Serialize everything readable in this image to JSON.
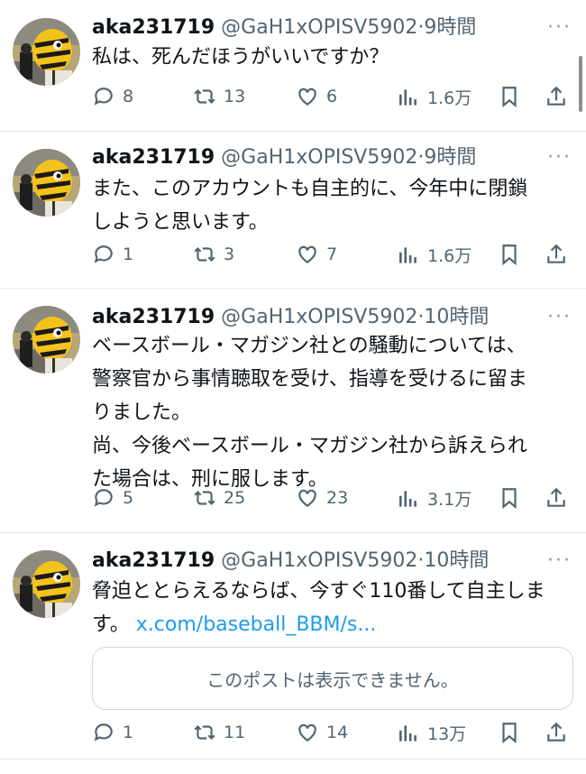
{
  "colors": {
    "link": "#1d9bf0",
    "muted": "#536471",
    "text": "#0f1419"
  },
  "tweets": [
    {
      "name": "aka231719",
      "handle": "@GaH1xOPISV5902",
      "dot": "·",
      "time": "9時間",
      "text": "私は、死んだほうがいいですか？",
      "replies": "8",
      "retweets": "13",
      "likes": "6",
      "views": "1.6万"
    },
    {
      "name": "aka231719",
      "handle": "@GaH1xOPISV5902",
      "dot": "·",
      "time": "9時間",
      "text": "また、このアカウントも自主的に、今年中に閉鎖\nしようと思います。",
      "replies": "1",
      "retweets": "3",
      "likes": "7",
      "views": "1.6万"
    },
    {
      "name": "aka231719",
      "handle": "@GaH1xOPISV5902",
      "dot": "·",
      "time": "10時間",
      "text": "ベースボール・マガジン社との騒動については、\n警察官から事情聴取を受け、指導を受けるに留ま\nりました。\n尚、今後ベースボール・マガジン社から訴えられ\nた場合は、刑に服します。",
      "replies": "5",
      "retweets": "25",
      "likes": "23",
      "views": "3.1万"
    },
    {
      "name": "aka231719",
      "handle": "@GaH1xOPISV5902",
      "dot": "·",
      "time": "10時間",
      "text": "脅迫ととらえるならば、今すぐ110番して自主しま\nす。 ",
      "link": "x.com/baseball_BBM/s...",
      "quote": "このポストは表示できません。",
      "replies": "1",
      "retweets": "11",
      "likes": "14",
      "views": "13万"
    }
  ],
  "more_label": "···"
}
